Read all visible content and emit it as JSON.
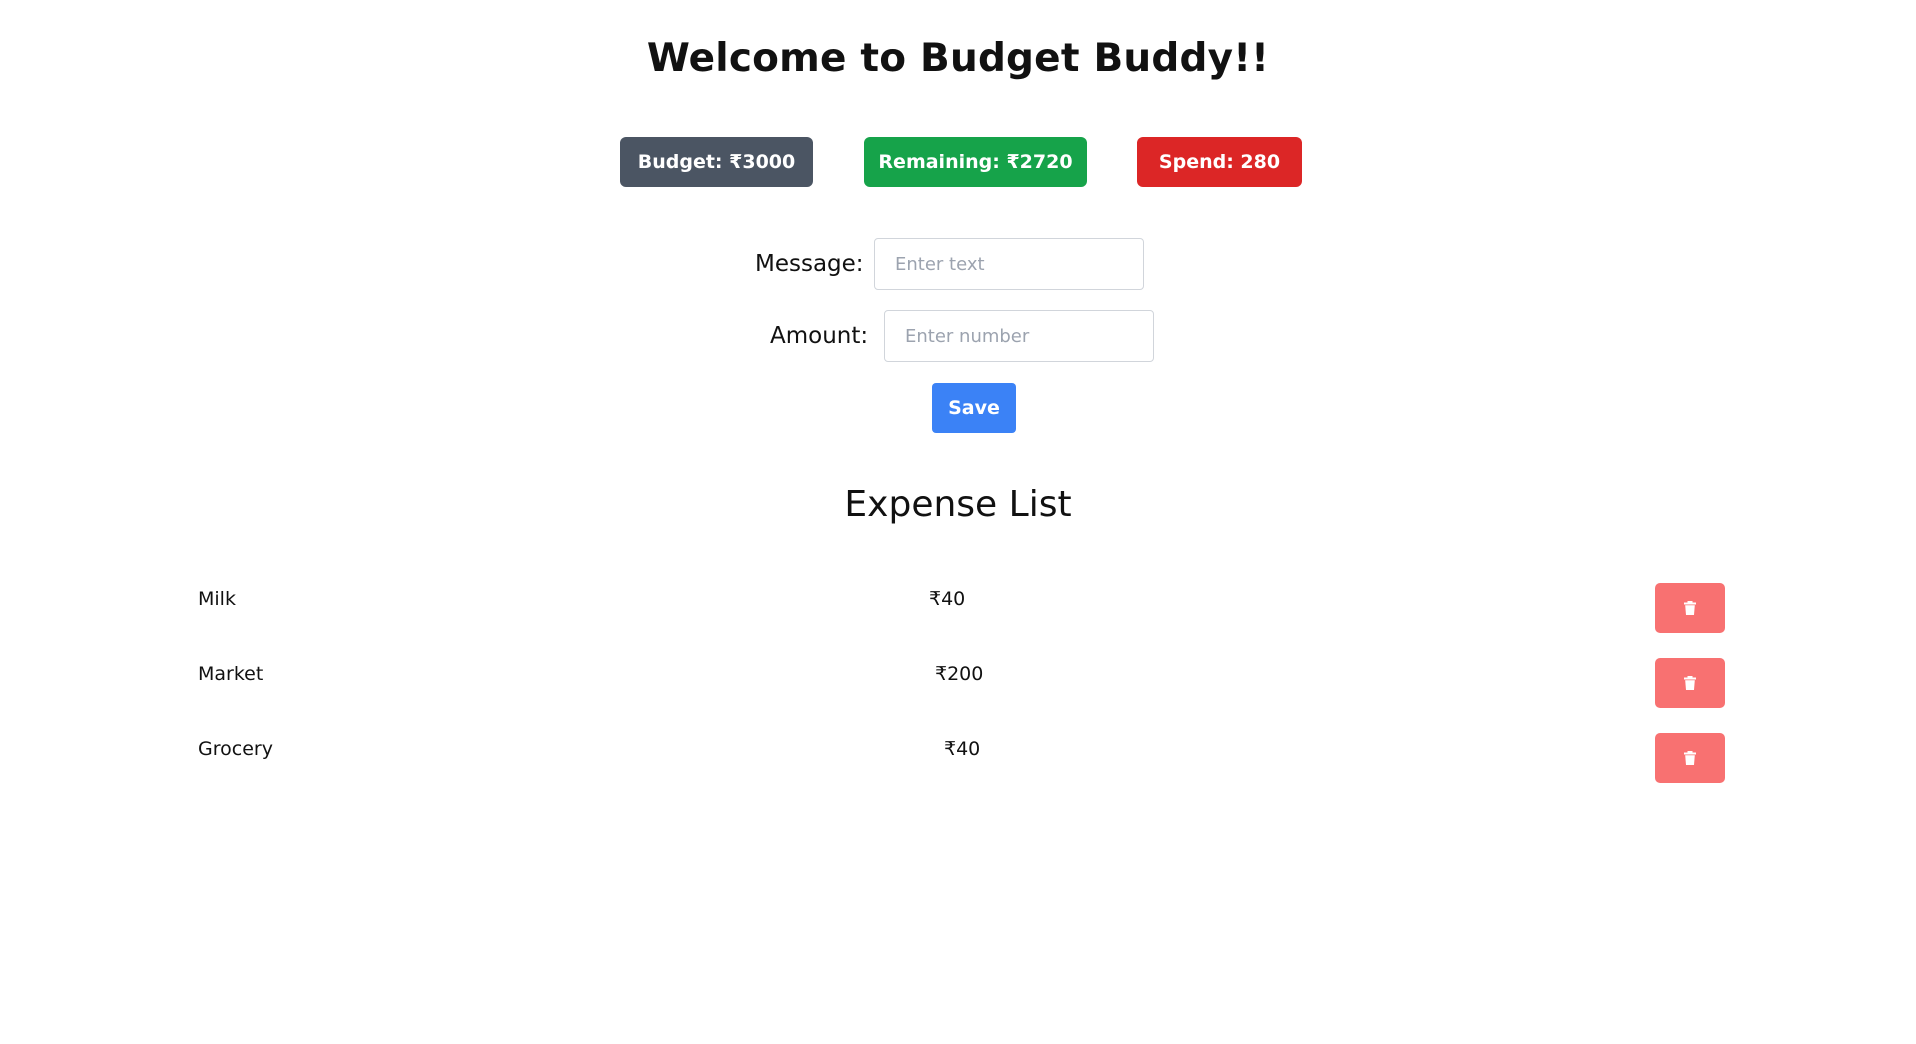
{
  "header": {
    "title": "Welcome to Budget Buddy!!"
  },
  "summary": {
    "budget_label": "Budget: ₹3000",
    "remaining_label": "Remaining: ₹2720",
    "spend_label": "Spend: 280"
  },
  "form": {
    "message_label": "Message:",
    "message_placeholder": "Enter text",
    "message_value": "",
    "amount_label": "Amount:",
    "amount_placeholder": "Enter number",
    "amount_value": "",
    "save_label": "Save"
  },
  "expense_list": {
    "heading": "Expense List",
    "items": [
      {
        "name": "Milk",
        "amount": "₹40"
      },
      {
        "name": "Market",
        "amount": "₹200"
      },
      {
        "name": "Grocery",
        "amount": "₹40"
      }
    ],
    "delete_icon": "trash-icon"
  },
  "colors": {
    "budget_badge": "#4b5563",
    "remaining_badge": "#16a34a",
    "spend_badge": "#dc2626",
    "save_button": "#3b82f6",
    "delete_button": "#f87171"
  }
}
